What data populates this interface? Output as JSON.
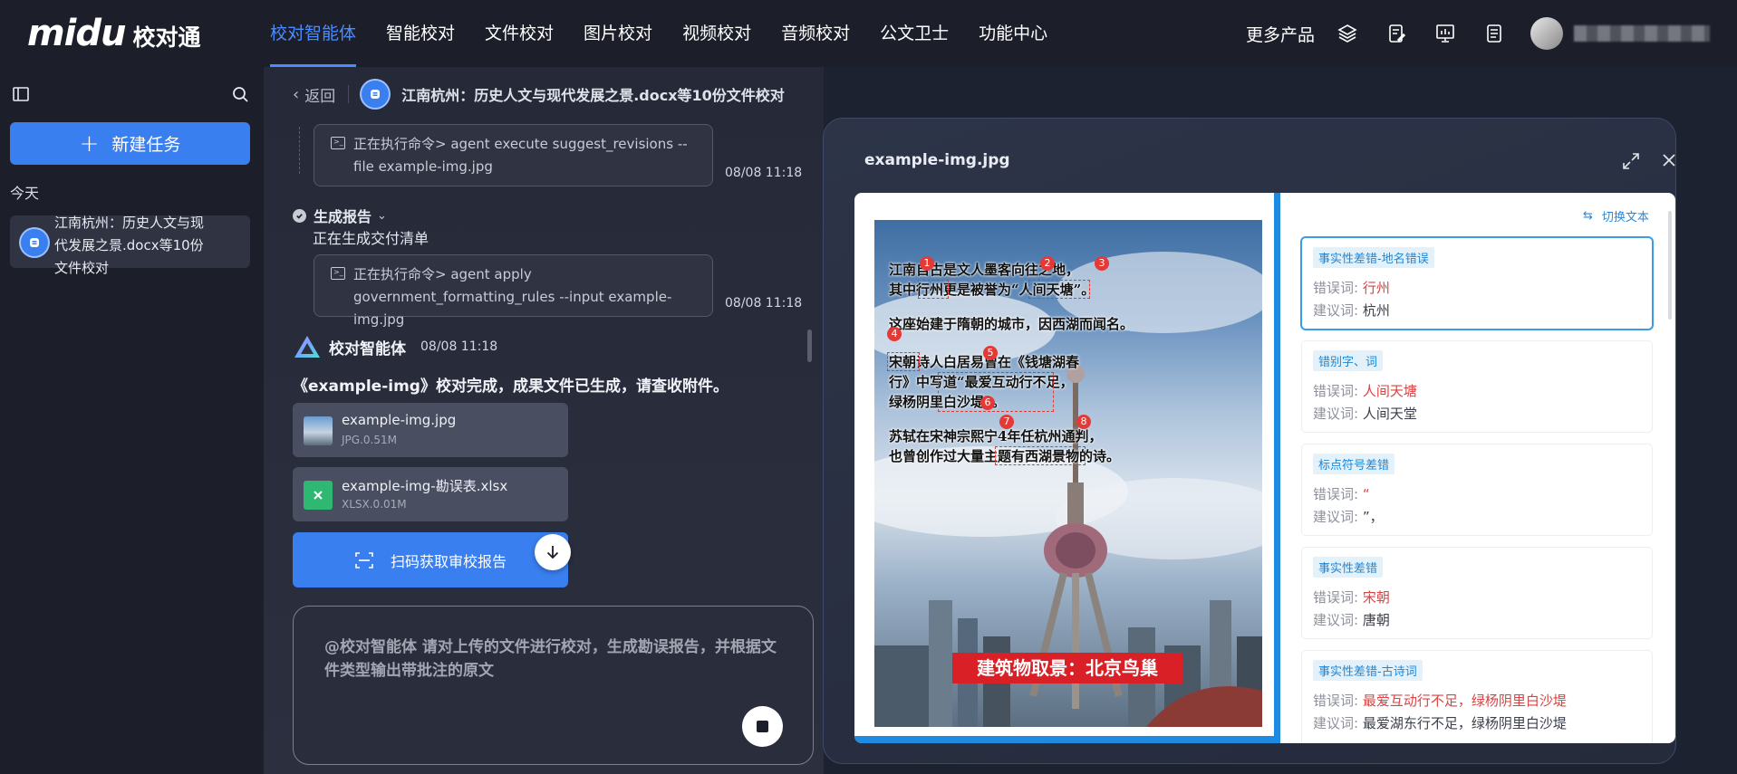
{
  "app": {
    "brand": "midu",
    "product": "校对通"
  },
  "nav": {
    "items": [
      "校对智能体",
      "智能校对",
      "文件校对",
      "图片校对",
      "视频校对",
      "音频校对",
      "公文卫士",
      "功能中心"
    ],
    "active_index": 0
  },
  "topbar": {
    "more_products": "更多产品"
  },
  "sidebar": {
    "new_task_label": "新建任务",
    "today_label": "今天",
    "tasks": [
      {
        "title": "江南杭州：历史人文与现代发展之景.docx等10份文件校对"
      }
    ]
  },
  "conversation": {
    "back_label": "返回",
    "title": "江南杭州：历史人文与现代发展之景.docx等10份文件校对",
    "commands": [
      {
        "text": "正在执行命令> agent execute suggest_revisions --file example-img.jpg",
        "time": "08/08 11:18"
      },
      {
        "text": "正在执行命令> agent apply government_formatting_rules --input example-img.jpg",
        "time": "08/08 11:18"
      }
    ],
    "step": {
      "label": "生成报告",
      "sub": "正在生成交付清单"
    },
    "agent": {
      "name": "校对智能体",
      "time": "08/08 11:18"
    },
    "done_message": "《example-img》校对完成，成果文件已生成，请查收附件。",
    "files": [
      {
        "name": "example-img.jpg",
        "meta": "JPG.0.51M"
      },
      {
        "name": "example-img-勘误表.xlsx",
        "meta": "XLSX.0.01M"
      }
    ],
    "scan_label": "扫码获取审校报告",
    "input_prompt": "@校对智能体 请对上传的文件进行校对，生成勘误报告，并根据文件类型输出带批注的原文"
  },
  "preview": {
    "title": "example-img.jpg",
    "switch_label": "切换文本",
    "image_lines": [
      "江南自古是文人墨客向往之地，",
      "其中行州更是被誉为“人间天塘”。",
      "这座始建于隋朝的城市，因西湖而闻名。",
      "宋朝诗人白居易曾在《钱塘湖春",
      "行》中写道“最爱互动行不足，",
      "绿杨阴里白沙堤”。",
      "苏轼在宋神宗熙宁4年任杭州通判，",
      "也曾创作过大量主题有西湖景物的诗。"
    ],
    "image_caption": "建筑物取景：北京鸟巢",
    "markers": [
      "1",
      "2",
      "3",
      "4",
      "5",
      "6",
      "7",
      "8"
    ],
    "errors": [
      {
        "tag": "事实性差错-地名错误",
        "wrong_label": "错误词:",
        "wrong": "行州",
        "sug_label": "建议词:",
        "suggest": "杭州"
      },
      {
        "tag": "错别字、词",
        "wrong_label": "错误词:",
        "wrong": "人间天塘",
        "sug_label": "建议词:",
        "suggest": "人间天堂"
      },
      {
        "tag": "标点符号差错",
        "wrong_label": "错误词:",
        "wrong": "“",
        "sug_label": "建议词:",
        "suggest": "”，"
      },
      {
        "tag": "事实性差错",
        "wrong_label": "错误词:",
        "wrong": "宋朝",
        "sug_label": "建议词:",
        "suggest": "唐朝"
      },
      {
        "tag": "事实性差错-古诗词",
        "wrong_label": "错误词:",
        "wrong": "最爱互动行不足，绿杨阴里白沙堤",
        "sug_label": "建议词:",
        "suggest": "最爱湖东行不足，绿杨阴里白沙堤"
      }
    ]
  },
  "colors": {
    "accent": "#3a7ff0",
    "nav_active": "#4a8cff",
    "error_red": "#d94343",
    "tag_blue": "#1f86d4"
  }
}
